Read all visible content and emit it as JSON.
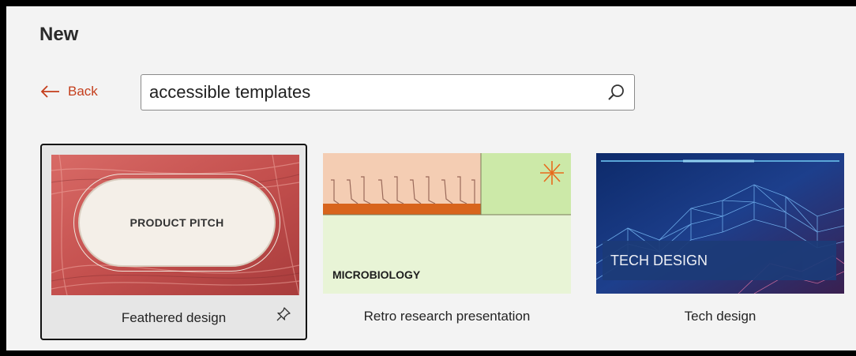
{
  "header": {
    "title": "New"
  },
  "nav": {
    "back_label": "Back"
  },
  "search": {
    "value": "accessible templates"
  },
  "templates": [
    {
      "name": "Feathered design",
      "thumb_text": "PRODUCT PITCH",
      "selected": true
    },
    {
      "name": "Retro research presentation",
      "thumb_text": "MICROBIOLOGY",
      "selected": false
    },
    {
      "name": "Tech design",
      "thumb_text": "TECH DESIGN",
      "selected": false
    }
  ],
  "colors": {
    "accent": "#c43e1c",
    "selected_bg": "#e6e6e6",
    "panel_bg": "#f3f3f3"
  },
  "icons": {
    "back": "arrow-left-icon",
    "search": "search-icon",
    "pin": "pin-icon"
  }
}
